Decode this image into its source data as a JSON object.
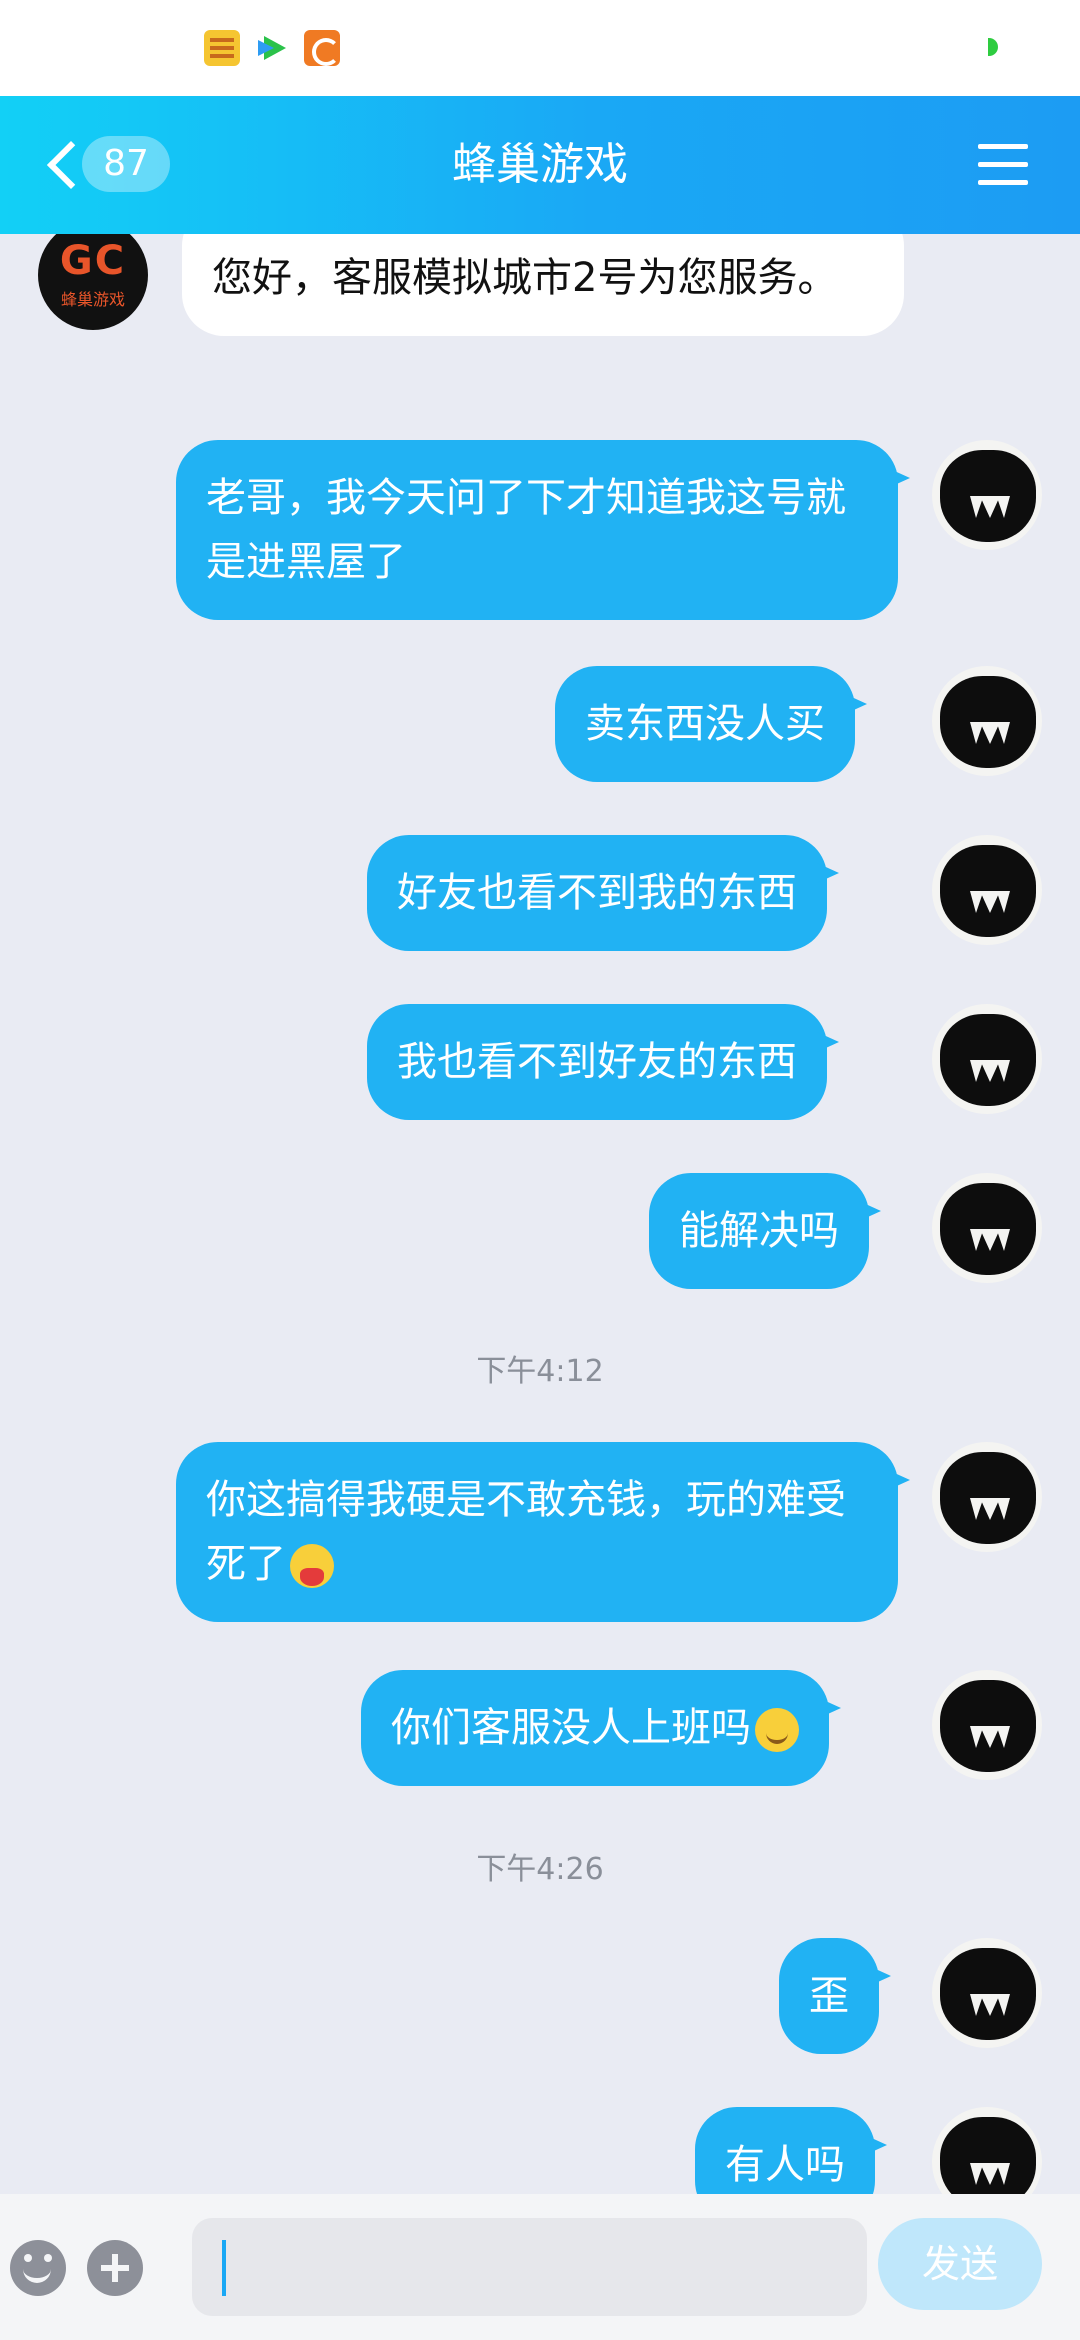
{
  "status_bar": {
    "icons": [
      "news-app-icon",
      "video-app-icon",
      "uc-browser-icon"
    ]
  },
  "header": {
    "back_icon": "chevron-left-icon",
    "unread_count": "87",
    "title": "蜂巢游戏",
    "menu_icon": "hamburger-menu-icon"
  },
  "chat": {
    "bot_avatar_label": "GC",
    "bot_avatar_sub": "蜂巢游戏",
    "messages": [
      {
        "from": "agent",
        "text": "您好，客服模拟城市2号为您服务。"
      },
      {
        "from": "me",
        "text": "老哥，我今天问了下才知道我这号就是进黑屋了"
      },
      {
        "from": "me",
        "text": "卖东西没人买"
      },
      {
        "from": "me",
        "text": "好友也看不到我的东西"
      },
      {
        "from": "me",
        "text": "我也看不到好友的东西"
      },
      {
        "from": "me",
        "text": "能解决吗"
      },
      {
        "from": "me",
        "text": "你这搞得我硬是不敢充钱，玩的难受死了",
        "emoji": "vomit-emoji"
      },
      {
        "from": "me",
        "text": "你们客服没人上班吗",
        "emoji": "upside-down-smile-emoji"
      },
      {
        "from": "me",
        "text": "歪"
      },
      {
        "from": "me",
        "text": "有人吗"
      }
    ],
    "timestamps": [
      "下午4:12",
      "下午4:26"
    ]
  },
  "input_bar": {
    "emoji_icon": "emoji-icon",
    "plus_icon": "plus-icon",
    "input_value": "",
    "send_label": "发送"
  },
  "colors": {
    "header_gradient_start": "#12d0f6",
    "header_gradient_end": "#1c9cf3",
    "outgoing_bubble": "#21b2f3",
    "incoming_bubble": "#ffffff",
    "chat_background": "#e9ebf3",
    "send_button": "#bfe7fb"
  }
}
